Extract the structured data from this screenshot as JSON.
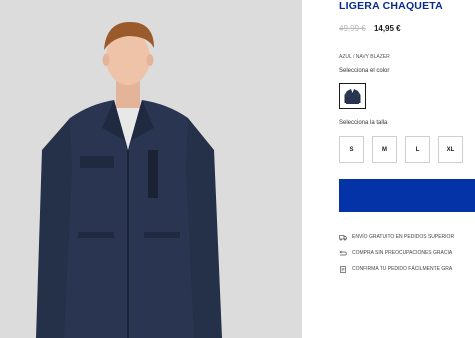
{
  "product": {
    "title": "LIGERA CHAQUETA",
    "old_price": "49,99 €",
    "new_price": "14,95 €",
    "color_name": "AZUL / NAVY BLAZER",
    "color_label": "Selecciona el color",
    "size_label": "Selecciona la talla",
    "sizes": [
      "S",
      "M",
      "L",
      "XL"
    ]
  },
  "benefits": [
    {
      "icon": "truck-icon",
      "text": "ENVÍO GRATUITO EN PEDIDOS SUPERIOR"
    },
    {
      "icon": "return-arrow-icon",
      "text": "COMPRA SIN PREOCUPACIONES GRACIA"
    },
    {
      "icon": "document-icon",
      "text": "CONFIRMA TU PEDIDO FÁCILMENTE GRA"
    }
  ],
  "colors": {
    "brand_blue": "#0433a8",
    "title_blue": "#0a2a8c",
    "jacket_navy": "#2a3552",
    "photo_background": "#dcdcdc"
  }
}
